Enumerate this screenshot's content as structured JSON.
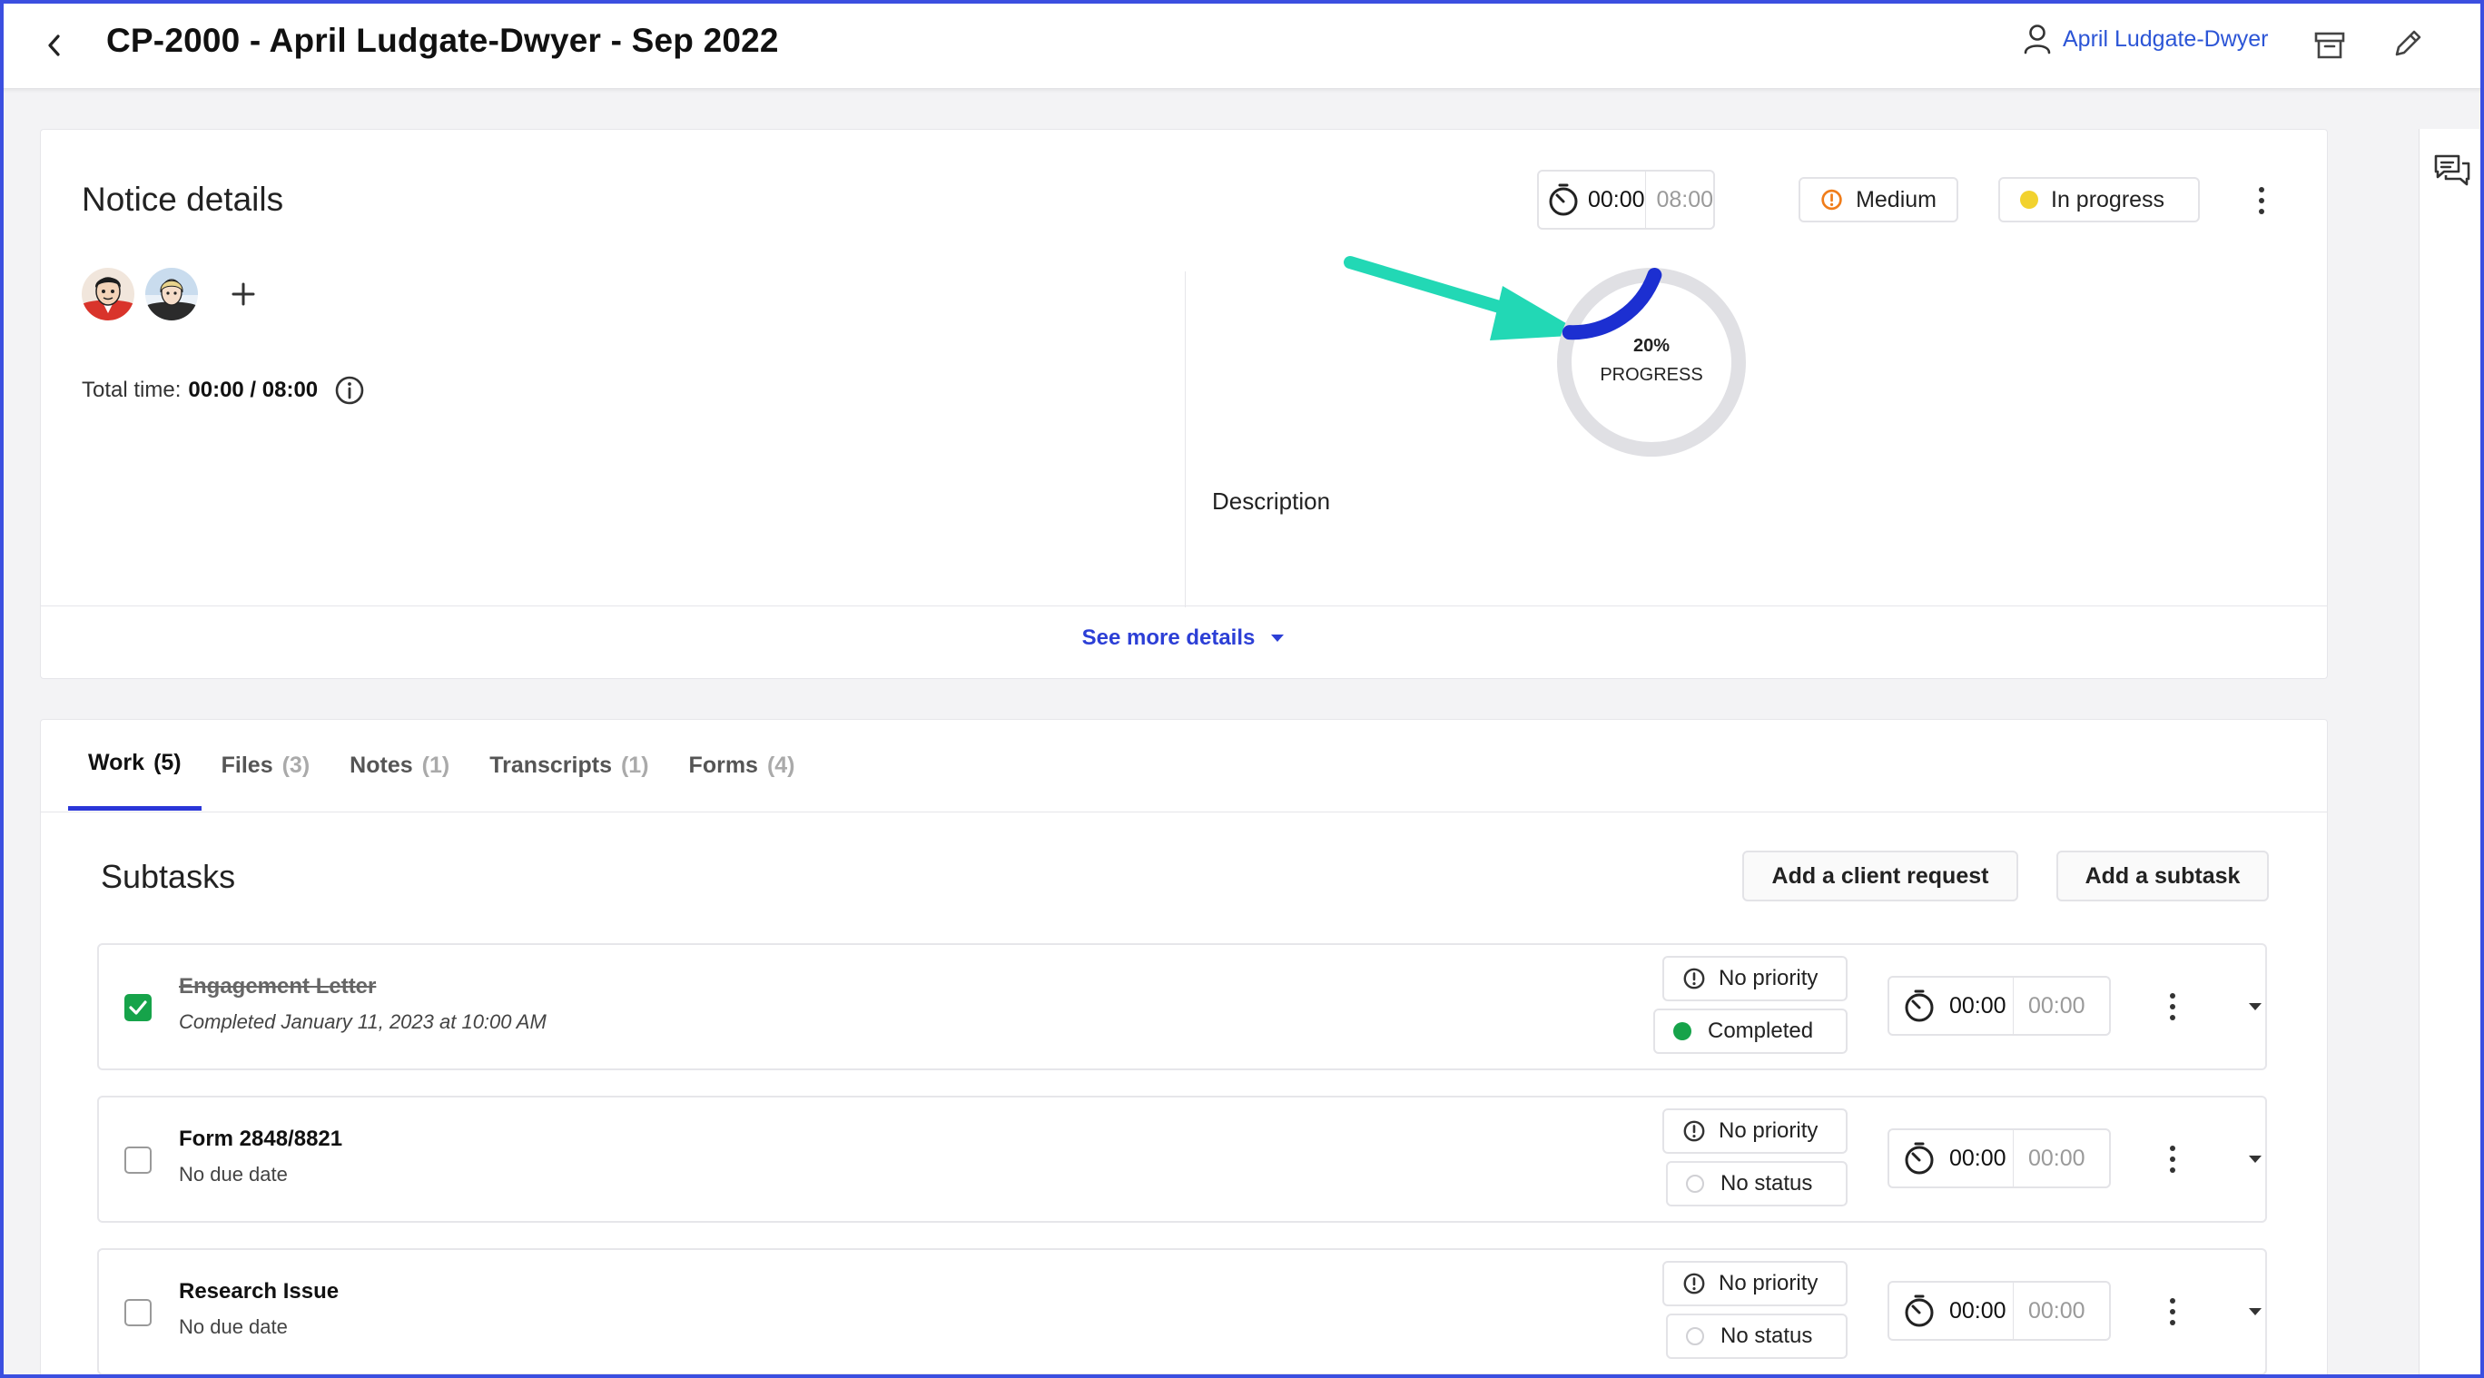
{
  "header": {
    "title": "CP-2000 - April Ludgate-Dwyer - Sep 2022",
    "user_name": "April Ludgate-Dwyer"
  },
  "notice": {
    "title": "Notice details",
    "timer": {
      "elapsed": "00:00",
      "estimate": "08:00"
    },
    "priority": {
      "label": "Medium",
      "color": "#f07d1a"
    },
    "status": {
      "label": "In progress",
      "color": "#f2d22e"
    },
    "total_time_label": "Total time:",
    "total_time_value": "00:00 / 08:00",
    "progress": {
      "percent": 20,
      "percent_label": "20%",
      "caption": "PROGRESS",
      "color": "#1c2fd1",
      "track_color": "#e0e0e4"
    },
    "description_label": "Description",
    "see_more_label": "See more details"
  },
  "tabs": [
    {
      "label": "Work",
      "count": "(5)"
    },
    {
      "label": "Files",
      "count": "(3)"
    },
    {
      "label": "Notes",
      "count": "(1)"
    },
    {
      "label": "Transcripts",
      "count": "(1)"
    },
    {
      "label": "Forms",
      "count": "(4)"
    }
  ],
  "subtasks": {
    "title": "Subtasks",
    "add_client_request_label": "Add a client request",
    "add_subtask_label": "Add a subtask",
    "items": [
      {
        "name": "Engagement Letter",
        "subtitle": "Completed January 11, 2023 at 10:00 AM",
        "priority": "No priority",
        "status": "Completed",
        "status_color": "#16a34a",
        "elapsed": "00:00",
        "estimate": "00:00"
      },
      {
        "name": "Form 2848/8821",
        "subtitle": "No due date",
        "priority": "No priority",
        "status": "No status",
        "elapsed": "00:00",
        "estimate": "00:00"
      },
      {
        "name": "Research Issue",
        "subtitle": "No due date",
        "priority": "No priority",
        "status": "No status",
        "elapsed": "00:00",
        "estimate": "00:00"
      }
    ]
  }
}
